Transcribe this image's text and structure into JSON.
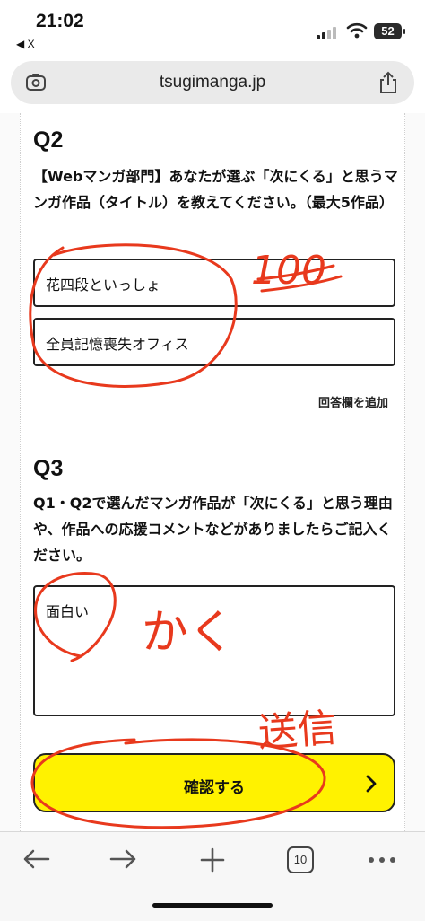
{
  "status_bar": {
    "time": "21:02",
    "back_app": "◀ X",
    "battery": "52"
  },
  "browser": {
    "url": "tsugimanga.jp",
    "tab_count": "10"
  },
  "q2": {
    "title": "Q2",
    "text": "【Webマンガ部門】あなたが選ぶ「次にくる」と思うマンガ作品（タイトル）を教えてください。（最大5作品）",
    "answers": [
      "花四段といっしょ",
      "全員記憶喪失オフィス"
    ],
    "add_label": "回答欄を追加"
  },
  "q3": {
    "title": "Q3",
    "text": "Q1・Q2で選んだマンガ作品が「次にくる」と思う理由や、作品への応援コメントなどがありましたらご記入ください。",
    "answer": "面白い"
  },
  "submit": {
    "label": "確認する"
  },
  "annotations": {
    "count_note": "100",
    "write_note": "かく",
    "send_note": "送信",
    "color": "#e8391d"
  },
  "colors": {
    "button_bg": "#fff200",
    "accent": "#e8391d"
  }
}
